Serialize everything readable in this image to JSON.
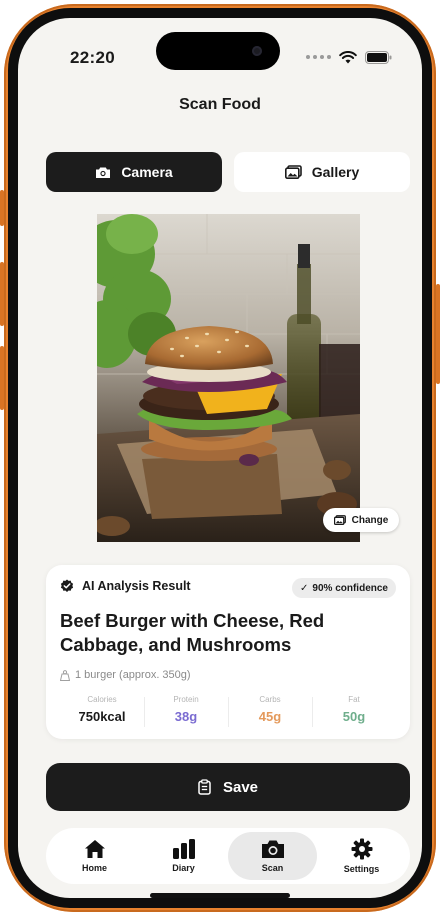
{
  "status_bar": {
    "time": "22:20"
  },
  "header": {
    "title": "Scan Food"
  },
  "source_toggle": {
    "camera_label": "Camera",
    "gallery_label": "Gallery",
    "selected": "Camera"
  },
  "photo": {
    "change_label": "Change"
  },
  "result": {
    "heading": "AI Analysis Result",
    "confidence": "90% confidence",
    "food_name": "Beef Burger with Cheese, Red Cabbage, and Mushrooms",
    "portion": "1 burger (approx. 350g)",
    "macros": [
      {
        "label": "Calories",
        "value": "750",
        "unit": "kcal",
        "color": "#1a1a1a"
      },
      {
        "label": "Protein",
        "value": "38",
        "unit": "g",
        "color": "#7a6bd1"
      },
      {
        "label": "Carbs",
        "value": "45",
        "unit": "g",
        "color": "#e49a5c"
      },
      {
        "label": "Fat",
        "value": "50",
        "unit": "g",
        "color": "#6fae8c"
      }
    ]
  },
  "actions": {
    "save_label": "Save"
  },
  "tabs": [
    {
      "label": "Home",
      "icon": "house-icon"
    },
    {
      "label": "Diary",
      "icon": "bar-chart-icon"
    },
    {
      "label": "Scan",
      "icon": "camera-icon",
      "active": true
    },
    {
      "label": "Settings",
      "icon": "gear-icon"
    }
  ],
  "colors": {
    "accent_dark": "#1c1c1c",
    "frame_orange": "#e8822e",
    "background": "#f5f4f1"
  }
}
